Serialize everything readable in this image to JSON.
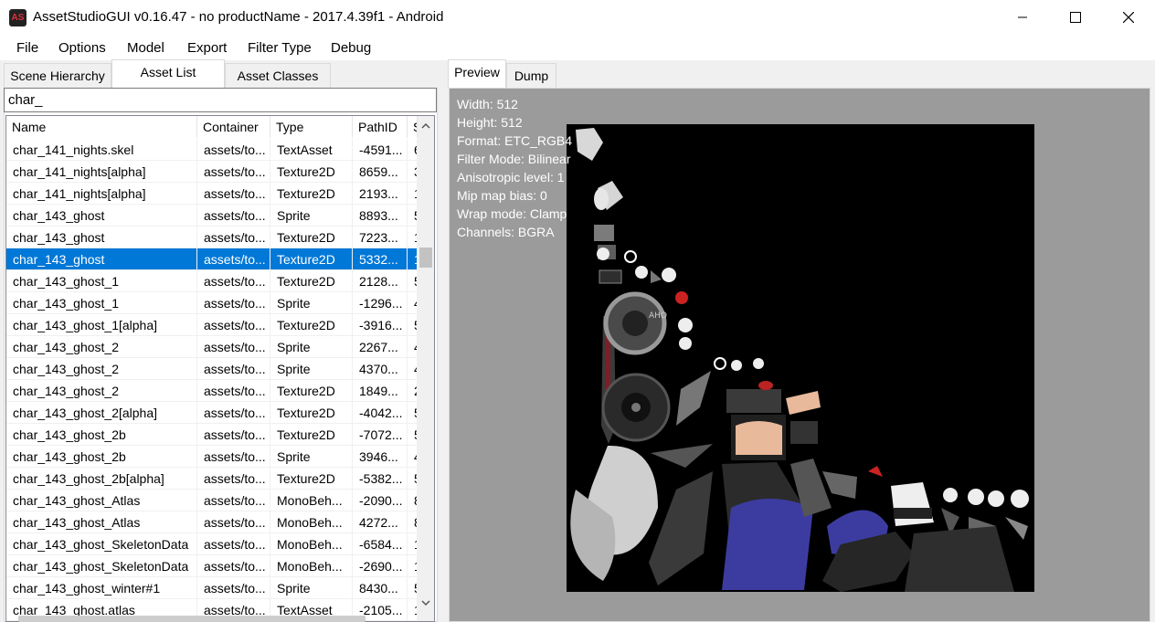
{
  "window": {
    "title": "AssetStudioGUI v0.16.47 - no productName - 2017.4.39f1 - Android",
    "icon_text": "AS"
  },
  "menu": [
    "File",
    "Options",
    "Model",
    "Export",
    "Filter Type",
    "Debug"
  ],
  "left_tabs": [
    "Scene Hierarchy",
    "Asset List",
    "Asset Classes"
  ],
  "left_active_tab": 1,
  "search": {
    "value": "char_"
  },
  "columns": [
    "Name",
    "Container",
    "Type",
    "PathID",
    "S"
  ],
  "rows": [
    {
      "name": "char_141_nights.skel",
      "container": "assets/to...",
      "type": "TextAsset",
      "pathid": "-4591...",
      "size": "6"
    },
    {
      "name": "char_141_nights[alpha]",
      "container": "assets/to...",
      "type": "Texture2D",
      "pathid": "8659...",
      "size": "3"
    },
    {
      "name": "char_141_nights[alpha]",
      "container": "assets/to...",
      "type": "Texture2D",
      "pathid": "2193...",
      "size": "1"
    },
    {
      "name": "char_143_ghost",
      "container": "assets/to...",
      "type": "Sprite",
      "pathid": "8893...",
      "size": "5"
    },
    {
      "name": "char_143_ghost",
      "container": "assets/to...",
      "type": "Texture2D",
      "pathid": "7223...",
      "size": "1"
    },
    {
      "name": "char_143_ghost",
      "container": "assets/to...",
      "type": "Texture2D",
      "pathid": "5332...",
      "size": "1",
      "selected": true
    },
    {
      "name": "char_143_ghost_1",
      "container": "assets/to...",
      "type": "Texture2D",
      "pathid": "2128...",
      "size": "5"
    },
    {
      "name": "char_143_ghost_1",
      "container": "assets/to...",
      "type": "Sprite",
      "pathid": "-1296...",
      "size": "4"
    },
    {
      "name": "char_143_ghost_1[alpha]",
      "container": "assets/to...",
      "type": "Texture2D",
      "pathid": "-3916...",
      "size": "5"
    },
    {
      "name": "char_143_ghost_2",
      "container": "assets/to...",
      "type": "Sprite",
      "pathid": "2267...",
      "size": "4"
    },
    {
      "name": "char_143_ghost_2",
      "container": "assets/to...",
      "type": "Sprite",
      "pathid": "4370...",
      "size": "4"
    },
    {
      "name": "char_143_ghost_2",
      "container": "assets/to...",
      "type": "Texture2D",
      "pathid": "1849...",
      "size": "2"
    },
    {
      "name": "char_143_ghost_2[alpha]",
      "container": "assets/to...",
      "type": "Texture2D",
      "pathid": "-4042...",
      "size": "5"
    },
    {
      "name": "char_143_ghost_2b",
      "container": "assets/to...",
      "type": "Texture2D",
      "pathid": "-7072...",
      "size": "5"
    },
    {
      "name": "char_143_ghost_2b",
      "container": "assets/to...",
      "type": "Sprite",
      "pathid": "3946...",
      "size": "4"
    },
    {
      "name": "char_143_ghost_2b[alpha]",
      "container": "assets/to...",
      "type": "Texture2D",
      "pathid": "-5382...",
      "size": "5"
    },
    {
      "name": "char_143_ghost_Atlas",
      "container": "assets/to...",
      "type": "MonoBeh...",
      "pathid": "-2090...",
      "size": "8"
    },
    {
      "name": "char_143_ghost_Atlas",
      "container": "assets/to...",
      "type": "MonoBeh...",
      "pathid": "4272...",
      "size": "8"
    },
    {
      "name": "char_143_ghost_SkeletonData",
      "container": "assets/to...",
      "type": "MonoBeh...",
      "pathid": "-6584...",
      "size": "1"
    },
    {
      "name": "char_143_ghost_SkeletonData",
      "container": "assets/to...",
      "type": "MonoBeh...",
      "pathid": "-2690...",
      "size": "1"
    },
    {
      "name": "char_143_ghost_winter#1",
      "container": "assets/to...",
      "type": "Sprite",
      "pathid": "8430...",
      "size": "5"
    },
    {
      "name": "char_143_ghost.atlas",
      "container": "assets/to...",
      "type": "TextAsset",
      "pathid": "-2105...",
      "size": "1"
    }
  ],
  "right_tabs": [
    "Preview",
    "Dump"
  ],
  "right_active_tab": 0,
  "texture_info": [
    "Width: 512",
    "Height: 512",
    "Format: ETC_RGB4",
    "Filter Mode: Bilinear",
    "Anisotropic level: 1",
    "Mip map bias: 0",
    "Wrap mode: Clamp",
    "Channels: BGRA"
  ],
  "colors": {
    "selection": "#0078d7",
    "preview_bg": "#9b9b9b",
    "texture_bg": "#000000",
    "icon_red": "#e0303a"
  },
  "icons": [
    "minimize-icon",
    "maximize-icon",
    "close-icon",
    "scroll-up-icon",
    "scroll-down-icon"
  ]
}
